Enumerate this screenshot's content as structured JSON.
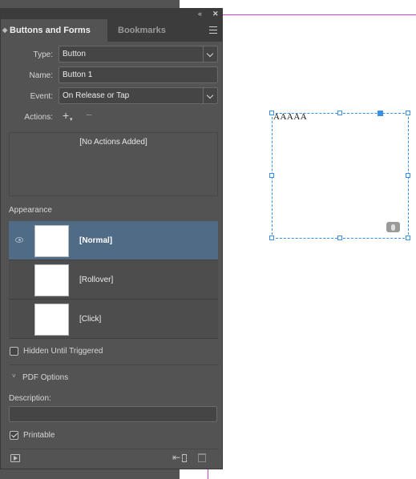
{
  "panel": {
    "tabs": [
      {
        "label": "Buttons and Forms"
      },
      {
        "label": "Bookmarks"
      }
    ],
    "collapse_icon": "double-chevron-left-icon",
    "close_icon": "close-icon",
    "type_label": "Type:",
    "type_value": "Button",
    "name_label": "Name:",
    "name_value": "Button 1",
    "event_label": "Event:",
    "event_value": "On Release or Tap",
    "actions_label": "Actions:",
    "actions_empty": "[No Actions Added]",
    "appearance_label": "Appearance",
    "states": [
      {
        "label": "[Normal]",
        "selected": true
      },
      {
        "label": "[Rollover]",
        "selected": false
      },
      {
        "label": "[Click]",
        "selected": false
      }
    ],
    "hidden_label": "Hidden Until Triggered",
    "hidden_checked": false,
    "pdf_options_label": "PDF Options",
    "description_label": "Description:",
    "description_value": "",
    "printable_label": "Printable",
    "printable_checked": true
  },
  "canvas": {
    "frame_text": "AAAAA"
  },
  "colors": {
    "panel_bg": "#535353",
    "selection": "#4f6b86",
    "frame_accent": "#3a8ee6",
    "guide": "#d63ad6"
  }
}
